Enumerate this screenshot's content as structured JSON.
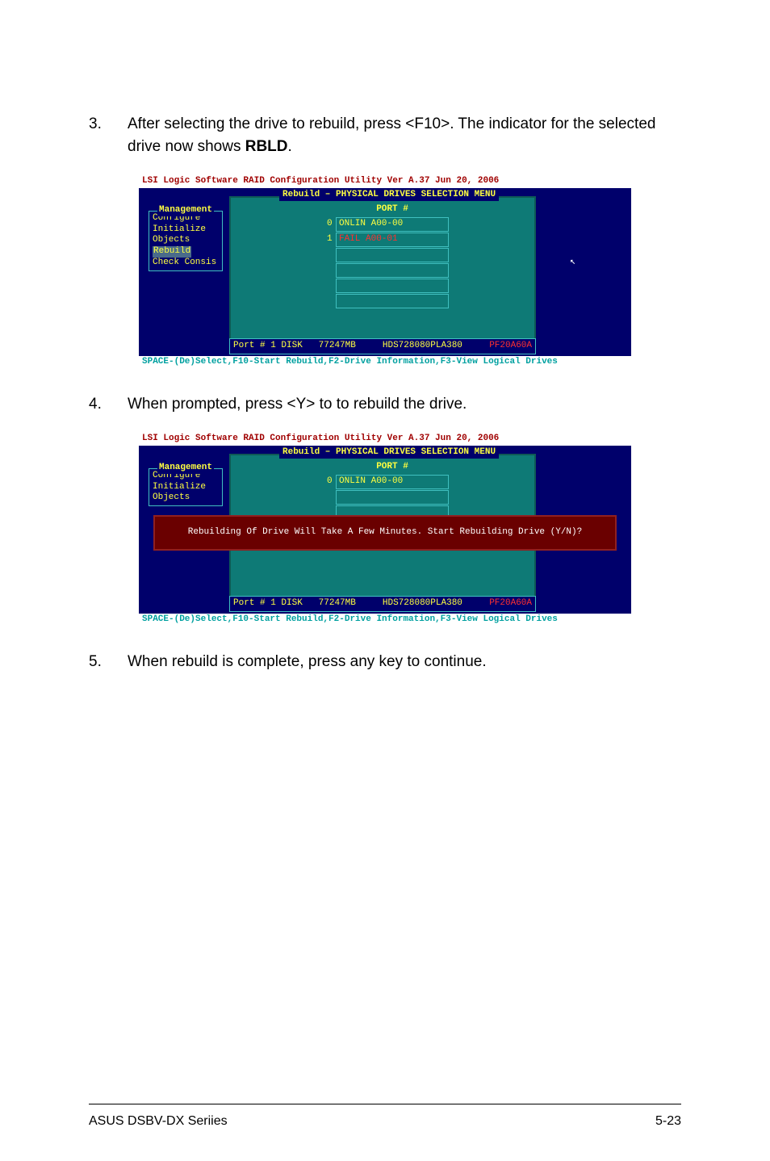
{
  "steps": {
    "s3_num": "3.",
    "s3_text_a": "After selecting the drive to rebuild, press <F10>. The indicator for the selected drive now shows ",
    "s3_bold": "RBLD",
    "s3_text_b": ".",
    "s4_num": "4.",
    "s4_text": "When prompted, press <Y> to to rebuild the drive.",
    "s5_num": "5.",
    "s5_text": "When rebuild is complete, press any key to continue."
  },
  "bios_common": {
    "top": "LSI Logic Software RAID Configuration Utility Ver A.37 Jun 20, 2006",
    "bottom": "SPACE-(De)Select,F10-Start Rebuild,F2-Drive Information,F3-View Logical Drives",
    "panel_title": "Rebuild – PHYSICAL DRIVES SELECTION MENU",
    "port_header": "PORT #",
    "mgmt_title": "Management",
    "info": {
      "port": "Port #  1 DISK",
      "size": "77247MB",
      "model": "HDS728080PLA380",
      "pf": "PF20A60A"
    }
  },
  "bios1": {
    "menu": [
      "Configure",
      "Initialize",
      "Objects",
      "Rebuild",
      "Check Consis"
    ],
    "menu_selected_index": 3,
    "drives": [
      {
        "idx": "0",
        "label": "ONLIN A00-00",
        "state": "onlin"
      },
      {
        "idx": "1",
        "label": "FAIL  A00-01",
        "state": "fail"
      }
    ],
    "empty_rows": 4,
    "cursor_glyph": "↖"
  },
  "bios2": {
    "menu": [
      "Configure",
      "Initialize",
      "Objects"
    ],
    "drives": [
      {
        "idx": "0",
        "label": "ONLIN A00-00",
        "state": "onlin"
      }
    ],
    "empty_rows": 2,
    "popup": "Rebuilding Of Drive Will Take A Few Minutes. Start Rebuilding Drive (Y/N)?"
  },
  "footer": {
    "left": "ASUS DSBV-DX Seriies",
    "right": "5-23"
  }
}
